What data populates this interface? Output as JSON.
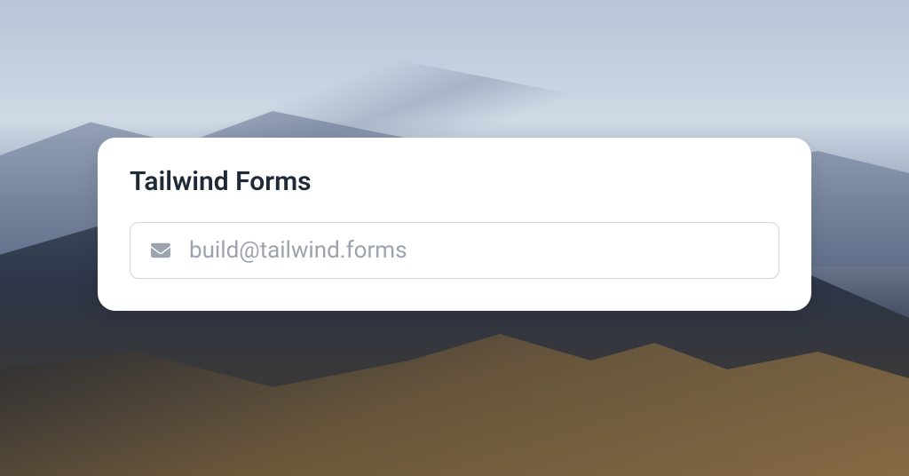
{
  "card": {
    "title": "Tailwind Forms",
    "email": {
      "placeholder": "build@tailwind.forms",
      "value": ""
    }
  }
}
